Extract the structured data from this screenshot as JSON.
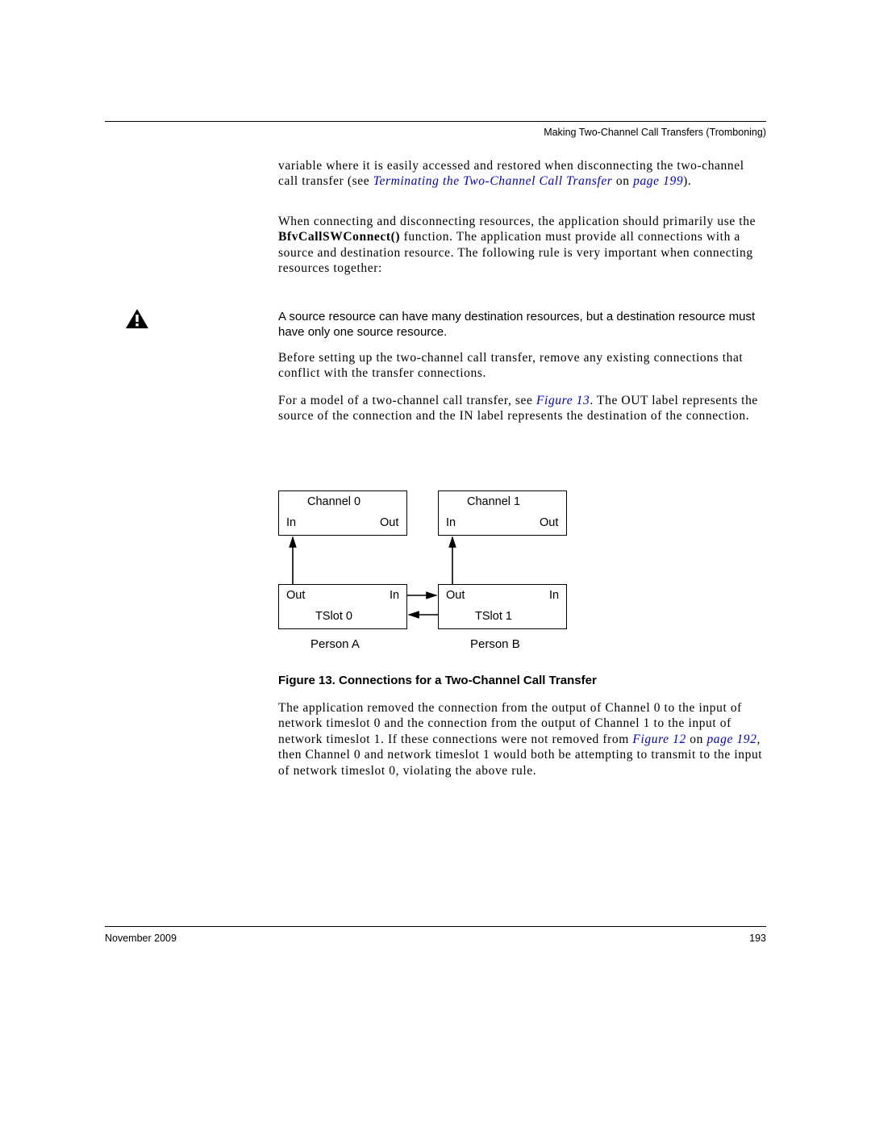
{
  "header": {
    "section_title": "Making Two-Channel Call Transfers (Tromboning)"
  },
  "para1_a": "variable where it is easily accessed and restored when disconnecting the two-channel call transfer (see ",
  "para1_link": "Terminating the Two-Channel Call Transfer",
  "para1_b": " on ",
  "para1_link2": "page 199",
  "para1_c": ").",
  "para2_a": "When connecting and disconnecting resources, the application should primarily use the ",
  "para2_bold": "BfvCallSWConnect()",
  "para2_b": " function. The application must provide all connections with a source and destination resource. The following rule is very important when connecting resources together:",
  "note": "A source resource can have many destination resources, but a destination resource must have only one source resource.",
  "para3": "Before setting up the two-channel call transfer, remove any existing connections that conflict with the transfer connections.",
  "para4_a": "For a model of a two-channel call transfer, see ",
  "para4_link": "Figure 13",
  "para4_b": ". The OUT label represents the source of the connection and the IN label represents the destination of the connection.",
  "diagram": {
    "ch0": "Channel 0",
    "ch1": "Channel 1",
    "inL": "In",
    "outL": "Out",
    "ts0": "TSlot 0",
    "ts1": "TSlot 1",
    "pA": "Person A",
    "pB": "Person B"
  },
  "fig_caption": "Figure 13.  Connections for a Two-Channel Call Transfer",
  "para5_a": "The application removed the connection from the output of Channel 0 to the input of network timeslot 0 and the connection from the output of Channel 1 to the input of network timeslot 1. If these connections were not removed from ",
  "para5_link1": "Figure 12",
  "para5_mid": " on ",
  "para5_link2": "page 192",
  "para5_b": ", then Channel 0 and network timeslot 1 would both be attempting to transmit to the input of network timeslot 0, violating the above rule.",
  "footer": {
    "date": "November 2009",
    "page": "193"
  }
}
